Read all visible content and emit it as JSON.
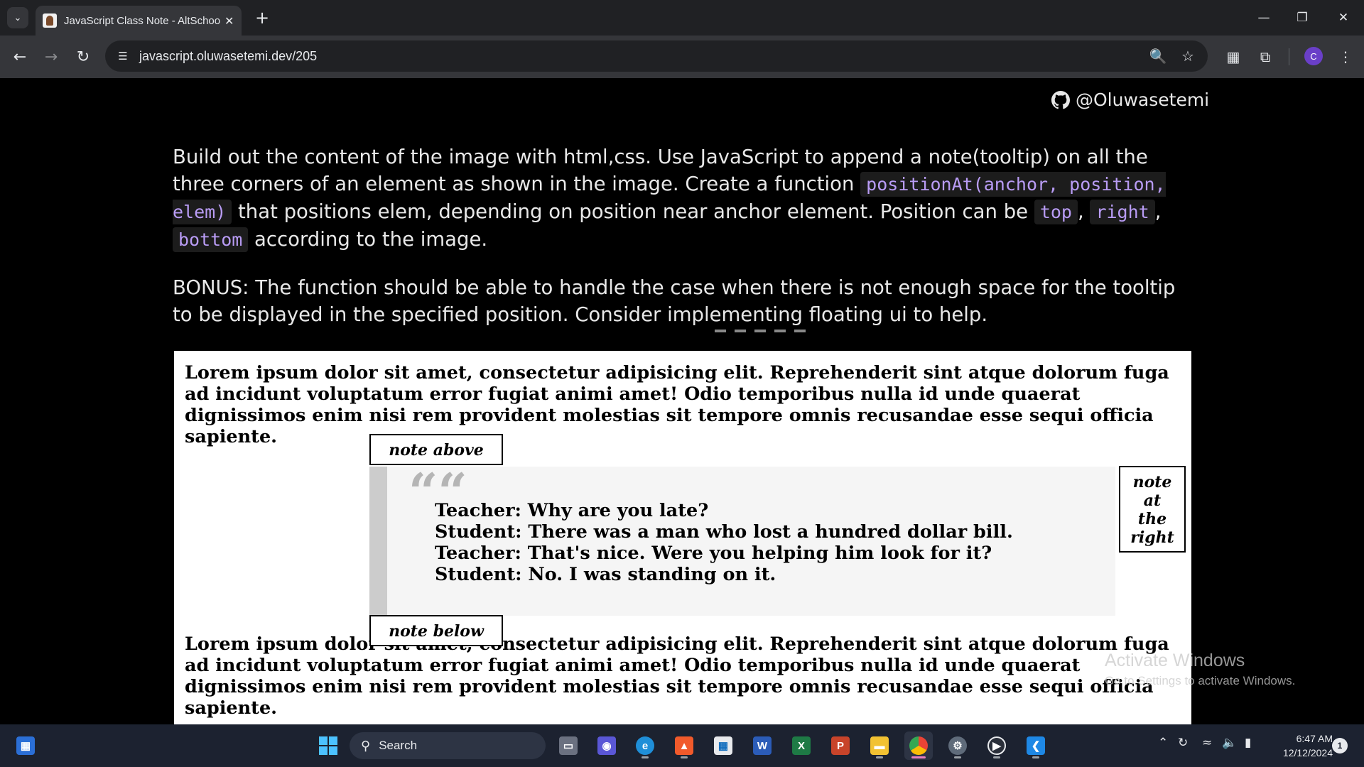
{
  "browser": {
    "tab_title": "JavaScript Class Note - AltSchool",
    "url": "javascript.oluwasetemi.dev/205",
    "profile_initial": "C"
  },
  "page": {
    "github_handle": "@Oluwasetemi",
    "intro": {
      "t1": "Build out the content of the image with html,css. Use JavaScript to append a note(tooltip) on all the three corners of an element as shown in the image. Create a function ",
      "code1": "positionAt(anchor, position, elem)",
      "t2": " that positions elem, depending on position near anchor element. Position can be ",
      "code_top": "top",
      "sep1": ", ",
      "code_right": "right",
      "sep2": ", ",
      "code_bottom": "bottom",
      "t3": " according to the image."
    },
    "bonus": "BONUS: The function should be able to handle the case when there is not enough space for the tooltip to be displayed in the specified position. Consider implementing floating ui to help.",
    "demo": {
      "lorem": "Lorem ipsum dolor sit amet, consectetur adipisicing elit. Reprehenderit sint atque dolorum fuga ad incidunt voluptatum error fugiat animi amet! Odio temporibus nulla id unde quaerat dignissimos enim nisi rem provident molestias sit tempore omnis recusandae esse sequi officia sapiente.",
      "quote_mark": "““",
      "dialogue": [
        "Teacher: Why are you late?",
        "Student: There was a man who lost a hundred dollar bill.",
        "Teacher: That's nice. Were you helping him look for it?",
        "Student: No. I was standing on it."
      ],
      "note_above": "note above",
      "note_below": "note below",
      "note_right": [
        "note",
        "at",
        "the",
        "right"
      ]
    },
    "watermark": {
      "title": "Activate Windows",
      "subtitle": "Go to Settings to activate Windows."
    }
  },
  "taskbar": {
    "search_label": "Search",
    "time": "6:47 AM",
    "date": "12/12/2024",
    "notification_count": "1"
  }
}
